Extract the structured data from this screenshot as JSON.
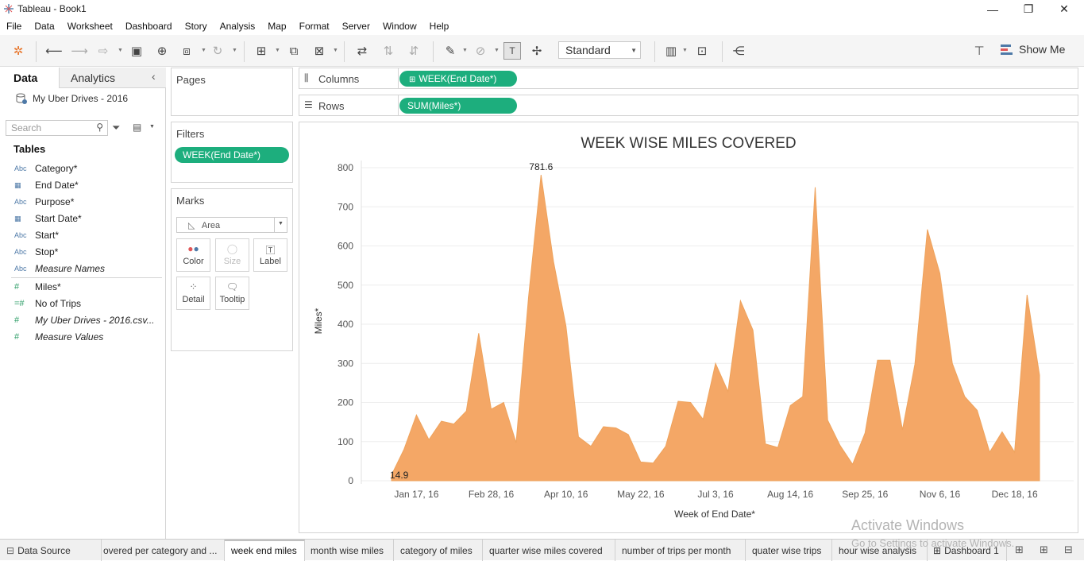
{
  "window": {
    "title": "Tableau - Book1",
    "minimize": "—",
    "restore": "❐",
    "close": "✕"
  },
  "menu": [
    "File",
    "Data",
    "Worksheet",
    "Dashboard",
    "Story",
    "Analysis",
    "Map",
    "Format",
    "Server",
    "Window",
    "Help"
  ],
  "toolbar": {
    "fit_value": "Standard",
    "show_me_label": "Show Me"
  },
  "data_pane": {
    "tab_data": "Data",
    "tab_analytics": "Analytics",
    "source_name": "My Uber Drives - 2016",
    "search_placeholder": "Search",
    "tables_header": "Tables",
    "dimensions": [
      {
        "type": "Abc",
        "name": "Category*"
      },
      {
        "type": "date",
        "name": "End Date*"
      },
      {
        "type": "Abc",
        "name": "Purpose*"
      },
      {
        "type": "date",
        "name": "Start Date*"
      },
      {
        "type": "Abc",
        "name": "Start*"
      },
      {
        "type": "Abc",
        "name": "Stop*"
      },
      {
        "type": "Abc",
        "name": "Measure Names"
      }
    ],
    "measures": [
      {
        "type": "#",
        "name": "Miles*"
      },
      {
        "type": "=#",
        "name": "No of Trips"
      },
      {
        "type": "#",
        "name": "My Uber Drives - 2016.csv..."
      },
      {
        "type": "#",
        "name": "Measure Values"
      }
    ]
  },
  "cards": {
    "pages_title": "Pages",
    "filters_title": "Filters",
    "filter_pill": "WEEK(End Date*)",
    "marks_title": "Marks",
    "mark_type": "Area",
    "mark_buttons": [
      "Color",
      "Size",
      "Label",
      "Detail",
      "Tooltip"
    ]
  },
  "shelves": {
    "columns_label": "Columns",
    "columns_pill": "WEEK(End Date*)",
    "rows_label": "Rows",
    "rows_pill": "SUM(Miles*)"
  },
  "chart_data": {
    "type": "area",
    "title": "WEEK WISE MILES COVERED",
    "xlabel": "Week of End Date*",
    "ylabel": "Miles*",
    "ylim": [
      0,
      800
    ],
    "yticks": [
      0,
      100,
      200,
      300,
      400,
      500,
      600,
      700,
      800
    ],
    "xtick_labels": [
      "Jan 17, 16",
      "Feb 28, 16",
      "Apr 10, 16",
      "May 22, 16",
      "Jul 3, 16",
      "Aug 14, 16",
      "Sep 25, 16",
      "Nov 6, 16",
      "Dec 18, 16"
    ],
    "x_start": "Jan 3, 16",
    "color": "#f4a766",
    "values": [
      14.9,
      80,
      168,
      105,
      152,
      145,
      178,
      377,
      183,
      200,
      97,
      470,
      781.6,
      560,
      395,
      112,
      88,
      138,
      135,
      118,
      48,
      45,
      88,
      203,
      200,
      157,
      300,
      228,
      460,
      385,
      94,
      85,
      192,
      215,
      750,
      155,
      90,
      42,
      122,
      308,
      308,
      130,
      298,
      642,
      530,
      300,
      215,
      180,
      73,
      125,
      73,
      475,
      270
    ],
    "annotations": [
      {
        "label": "781.6",
        "value": 781.6
      },
      {
        "label": "14.9",
        "value": 14.9
      }
    ],
    "grid": true
  },
  "sheet_tabs": {
    "data_source": "Data Source",
    "tabs": [
      "overed per category and ...",
      "week end miles",
      "month wise miles",
      "category of miles",
      "quarter wise miles covered",
      "number of trips per month",
      "quater wise trips",
      "hour wise analysis",
      "Dashboard 1"
    ],
    "active": "week end miles"
  },
  "watermark": {
    "line1": "Activate Windows",
    "line2": "Go to Settings to activate Windows."
  }
}
